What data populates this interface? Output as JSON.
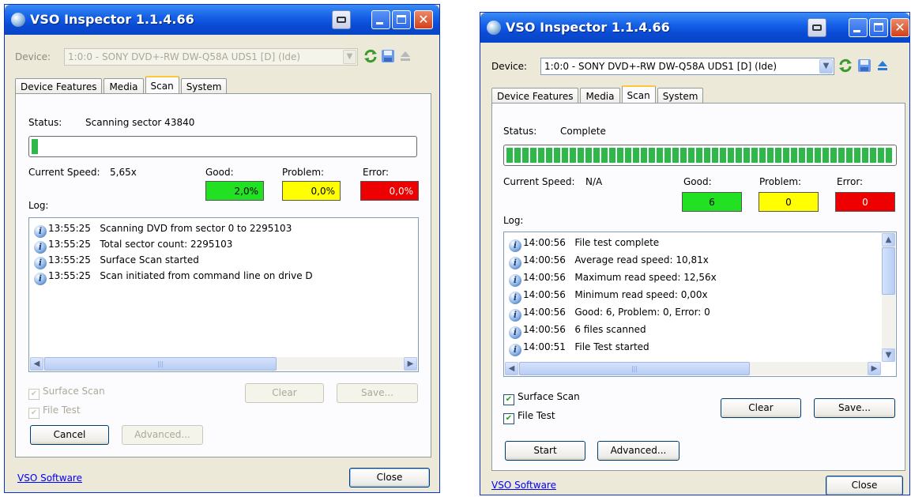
{
  "windows": [
    {
      "title": "VSO Inspector 1.1.4.66",
      "device_label": "Device:",
      "device_value": "1:0:0 - SONY DVD+-RW DW-Q58A UDS1 [D] (Ide)",
      "tabs": [
        {
          "label": "Device Features",
          "active": false
        },
        {
          "label": "Media",
          "active": false
        },
        {
          "label": "Scan",
          "active": true
        },
        {
          "label": "System",
          "active": false
        }
      ],
      "status_label": "Status:",
      "status_value": "Scanning sector 43840",
      "progress": 0.02,
      "speed_label": "Current Speed:",
      "speed_value": "5,65x",
      "good_label": "Good:",
      "good_value": "2,0%",
      "problem_label": "Problem:",
      "problem_value": "0,0%",
      "error_label": "Error:",
      "error_value": "0,0%",
      "log_label": "Log:",
      "log": [
        {
          "time": "13:55:25",
          "msg": "Scanning DVD from sector 0 to 2295103"
        },
        {
          "time": "13:55:25",
          "msg": "Total sector count: 2295103"
        },
        {
          "time": "13:55:25",
          "msg": "Surface Scan started"
        },
        {
          "time": "13:55:25",
          "msg": "Scan initiated from command line on drive D"
        }
      ],
      "surface_scan_label": "Surface Scan",
      "file_test_label": "File Test",
      "clear_label": "Clear",
      "save_label": "Save...",
      "primary_label": "Cancel",
      "advanced_label": "Advanced...",
      "footer_link": "VSO Software",
      "close_label": "Close"
    },
    {
      "title": "VSO Inspector 1.1.4.66",
      "device_label": "Device:",
      "device_value": "1:0:0 - SONY DVD+-RW DW-Q58A UDS1 [D] (Ide)",
      "tabs": [
        {
          "label": "Device Features",
          "active": false
        },
        {
          "label": "Media",
          "active": false
        },
        {
          "label": "Scan",
          "active": true
        },
        {
          "label": "System",
          "active": false
        }
      ],
      "status_label": "Status:",
      "status_value": "Complete",
      "progress": 1.0,
      "speed_label": "Current Speed:",
      "speed_value": "N/A",
      "good_label": "Good:",
      "good_value": "6",
      "problem_label": "Problem:",
      "problem_value": "0",
      "error_label": "Error:",
      "error_value": "0",
      "log_label": "Log:",
      "log": [
        {
          "time": "14:00:56",
          "msg": "File test complete"
        },
        {
          "time": "14:00:56",
          "msg": "Average read speed: 10,81x"
        },
        {
          "time": "14:00:56",
          "msg": "Maximum read speed: 12,56x"
        },
        {
          "time": "14:00:56",
          "msg": "Minimum read speed: 0,00x"
        },
        {
          "time": "14:00:56",
          "msg": "Good: 6, Problem: 0, Error: 0"
        },
        {
          "time": "14:00:56",
          "msg": "6 files scanned"
        },
        {
          "time": "14:00:51",
          "msg": "File Test started"
        }
      ],
      "surface_scan_label": "Surface Scan",
      "file_test_label": "File Test",
      "clear_label": "Clear",
      "save_label": "Save...",
      "primary_label": "Start",
      "advanced_label": "Advanced...",
      "footer_link": "VSO Software",
      "close_label": "Close"
    }
  ],
  "colors": {
    "good": "#22e022",
    "problem": "#ffff00",
    "error": "#ee0000",
    "progress": "#2fb84a"
  },
  "icons": [
    "camera-icon",
    "minimize-icon",
    "maximize-icon",
    "close-icon",
    "refresh-icon",
    "save-disk-icon",
    "eject-icon",
    "info-icon"
  ]
}
